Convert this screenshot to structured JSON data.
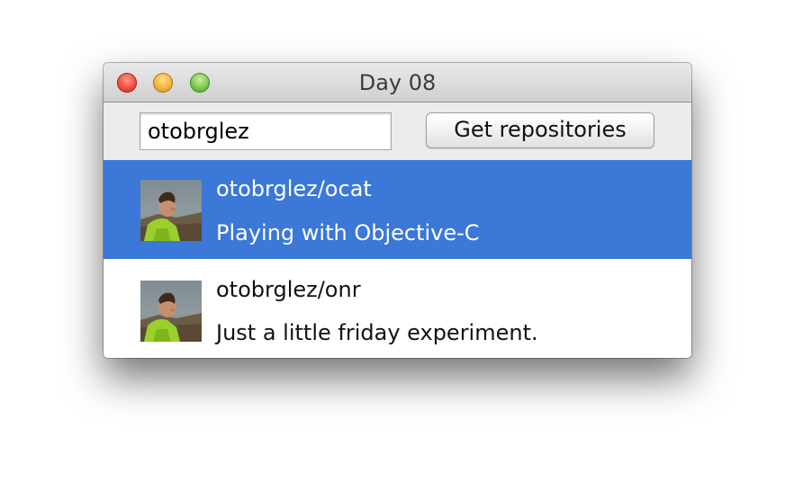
{
  "window": {
    "title": "Day 08"
  },
  "toolbar": {
    "username_value": "otobrglez",
    "get_button_label": "Get repositories"
  },
  "repositories": [
    {
      "name": "otobrglez/ocat",
      "description": "Playing with Objective-C",
      "selected": true
    },
    {
      "name": "otobrglez/onr",
      "description": "Just a little friday experiment.",
      "selected": false
    }
  ],
  "colors": {
    "selection": "#3b78d7",
    "window_bg": "#ececec"
  },
  "icons": {
    "close": "close-button-red",
    "minimize": "minimize-button-yellow",
    "zoom": "zoom-button-green"
  }
}
